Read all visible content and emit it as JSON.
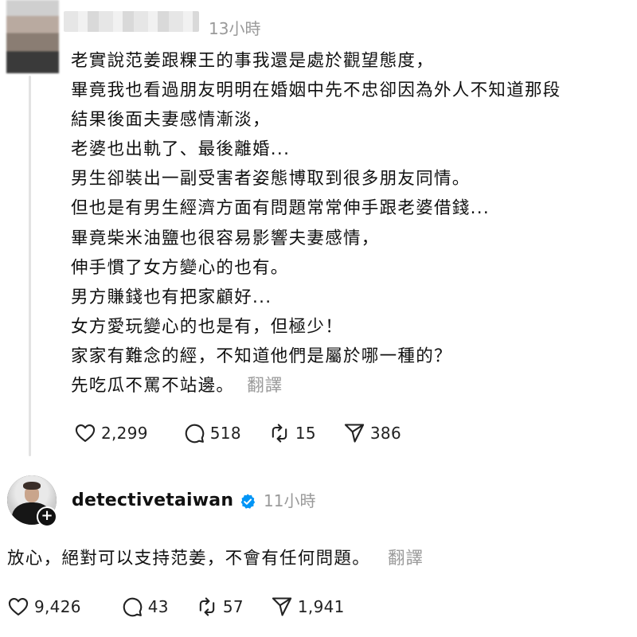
{
  "post1": {
    "timestamp": "13小時",
    "lines": [
      "老實說范姜跟粿王的事我還是處於觀望態度，",
      "畢竟我也看過朋友明明在婚姻中先不忠卻因為外人不知道那段",
      "結果後面夫妻感情漸淡，",
      "老婆也出軌了、最後離婚...",
      "男生卻裝出一副受害者姿態博取到很多朋友同情。",
      "但也是有男生經濟方面有問題常常伸手跟老婆借錢...",
      "畢竟柴米油鹽也很容易影響夫妻感情，",
      "伸手慣了女方變心的也有。",
      "男方賺錢也有把家顧好...",
      "女方愛玩變心的也是有，但極少！",
      "家家有難念的經，不知道他們是屬於哪一種的？",
      "先吃瓜不罵不站邊。"
    ],
    "translate_label": "翻譯",
    "stats": {
      "likes": "2,299",
      "comments": "518",
      "reposts": "15",
      "shares": "386"
    }
  },
  "post2": {
    "username": "detectivetaiwan",
    "timestamp": "11小時",
    "text": "放心，絕對可以支持范姜，不會有任何問題。",
    "translate_label": "翻譯",
    "stats": {
      "likes": "9,426",
      "comments": "43",
      "reposts": "57",
      "shares": "1,941"
    }
  },
  "icons": {
    "like": "heart-icon",
    "comment": "comment-bubble-icon",
    "repost": "repost-arrows-icon",
    "share": "send-paper-plane-icon",
    "verified": "verified-badge-icon",
    "follow": "plus-icon"
  },
  "colors": {
    "text": "#111111",
    "muted": "#9a9a9a",
    "verified": "#0095f6",
    "thread_line": "#e3e3e3"
  }
}
